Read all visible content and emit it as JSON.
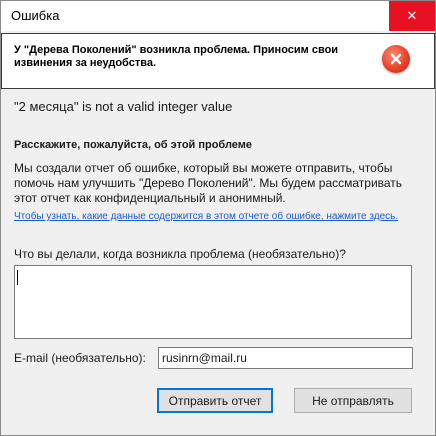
{
  "window": {
    "title": "Ошибка",
    "close_glyph": "✕"
  },
  "header": {
    "message": "У \"Дерева Поколений\" возникла проблема. Приносим свои извинения за неудобства.",
    "icon": "error-icon"
  },
  "error_message": "\"2 месяца\" is not a valid integer value",
  "report": {
    "section_title": "Расскажите, пожалуйста, об этой проблеме",
    "description": "Мы создали отчет об ошибке, который вы можете отправить, чтобы помочь нам улучшить \"Дерево Поколений\". Мы будем рассматривать этот отчет как конфиденциальный и анонимный.",
    "link_text": "Чтобы узнать, какие данные содержится в этом отчете об ошибке, нажмите здесь.",
    "question_label": "Что вы делали, когда возникла проблема (необязательно)?",
    "question_value": "",
    "email_label": "E-mail (необязательно):",
    "email_value": "rusinrn@mail.ru"
  },
  "buttons": {
    "send": "Отправить отчет",
    "dont_send": "Не отправлять"
  },
  "colors": {
    "close_bg": "#e81123",
    "link": "#1a5bd6",
    "primary_border": "#0078d7",
    "error_red": "#e8432c"
  }
}
